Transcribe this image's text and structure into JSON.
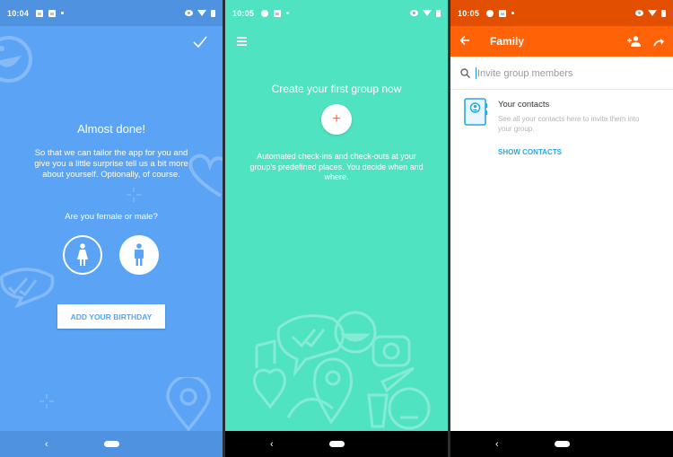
{
  "screens": [
    {
      "status": {
        "time": "10:04"
      },
      "confirm_icon": "checkmark-icon",
      "title": "Almost done!",
      "description": "So that we can tailor the app for you and give you a little surprise tell us a bit more about yourself. Optionally, of course.",
      "question": "Are you female or male?",
      "gender_options": [
        {
          "label": "female",
          "icon": "female-icon",
          "selected": false
        },
        {
          "label": "male",
          "icon": "male-icon",
          "selected": true
        }
      ],
      "birthday_button": "ADD YOUR BIRTHDAY",
      "colors": {
        "background": "#5ba3f5"
      }
    },
    {
      "status": {
        "time": "10:05"
      },
      "menu_icon": "hamburger-menu-icon",
      "title": "Create your first group now",
      "add_button": "+",
      "description": "Automated check-ins and check-outs at your group's predefined places. You decide when and where.",
      "colors": {
        "background": "#50e3c2",
        "accent": "#ff6a13"
      }
    },
    {
      "status": {
        "time": "10:05"
      },
      "appbar": {
        "title": "Family",
        "back_icon": "arrow-left-icon",
        "add_member_icon": "add-person-icon",
        "skip_icon": "redo-arrow-icon"
      },
      "search": {
        "value": "",
        "placeholder": "Invite group members"
      },
      "contacts": {
        "title": "Your contacts",
        "description": "See all your contacts here to invite them into your group.",
        "action": "SHOW CONTACTS"
      },
      "colors": {
        "appbar": "#ff6207",
        "statusbar": "#e24f00",
        "link": "#29a8e0"
      }
    }
  ]
}
